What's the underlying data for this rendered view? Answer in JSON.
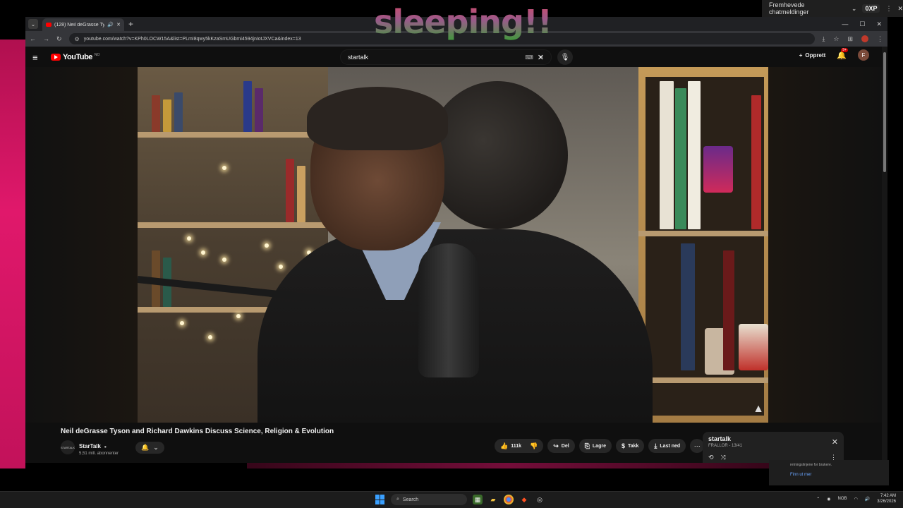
{
  "overlay": {
    "text": "sleeping!!"
  },
  "chatbar": {
    "label": "Fremhevede chatmeldinger",
    "chevron": "⌄",
    "badge": "0XP"
  },
  "browser": {
    "tab": {
      "title": "(128) Neil deGrasse Tyson a"
    },
    "url": "youtube.com/watch?v=KPh0LOCW15A&list=PLmI8qwy5kKzaSmUGbmi4594jnIotJXVCa&index=13"
  },
  "youtube": {
    "logo_text": "YouTube",
    "region": "NO",
    "search": {
      "value": "startalk"
    },
    "create_label": "Opprett",
    "notification_count": "9+",
    "user_initial": "F"
  },
  "video": {
    "title": "Neil deGrasse Tyson and Richard Dawkins Discuss Science, Religion & Evolution",
    "channel": {
      "name": "StarTalk",
      "subscribers": "5,51 mill. abonnenter",
      "avatar_text": "STARTALK"
    },
    "actions": {
      "likes": "111k",
      "share": "Del",
      "save": "Lagre",
      "thanks": "Takk",
      "download": "Last ned"
    }
  },
  "playlist": {
    "title": "startalk",
    "subtitle": "FRALLOR - 13/41"
  },
  "notification": {
    "text": "retningslinjene for brukere.",
    "link": "Finn ut mer"
  },
  "taskbar": {
    "search_placeholder": "Search",
    "lang": "NOB",
    "time": "7:42 AM",
    "date": "3/26/2026"
  }
}
